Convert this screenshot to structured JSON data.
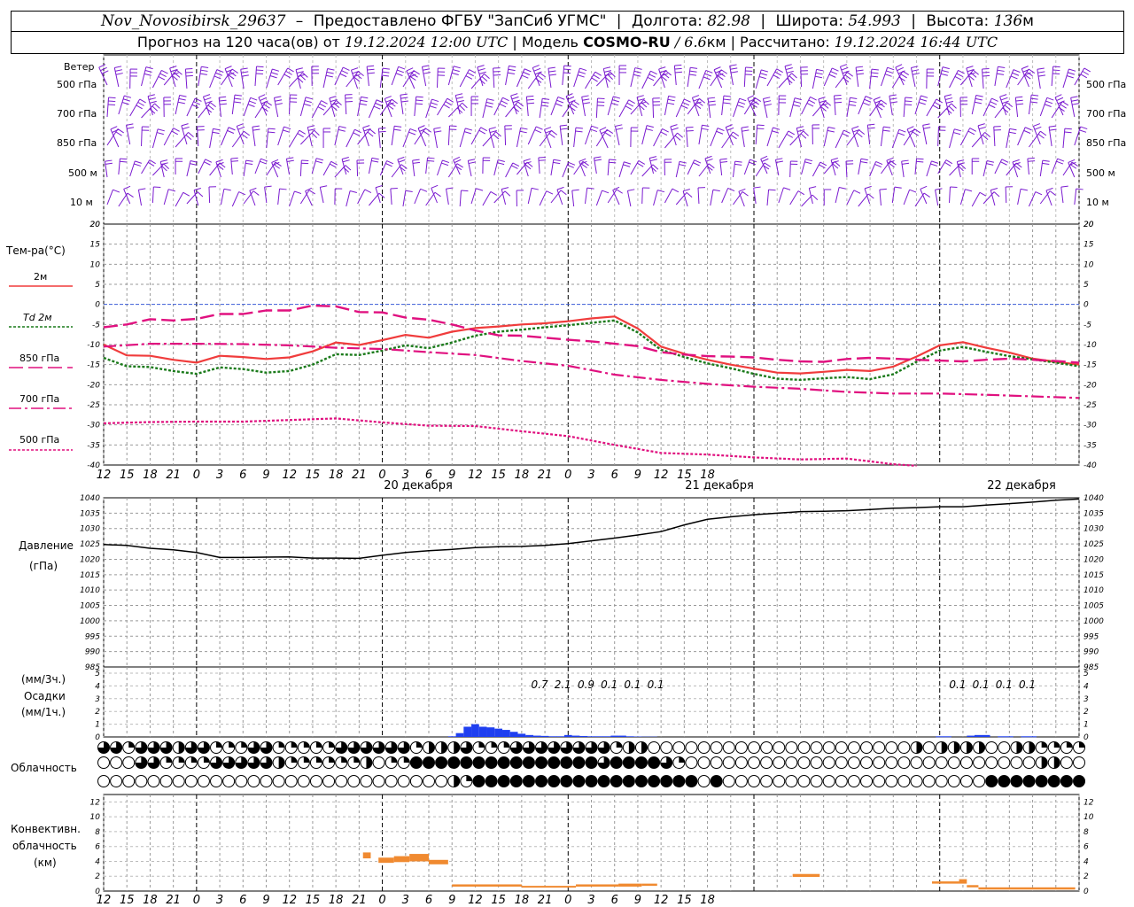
{
  "header": {
    "station": "Nov_Novosibirsk_29637",
    "dash": "–",
    "provider": "Предоставлено ФГБУ \"ЗапСиб УГМС\"",
    "lon_label": "Долгота:",
    "lon_value": "82.98",
    "lat_label": "Широта:",
    "lat_value": "54.993",
    "alt_label": "Высота:",
    "alt_value": "136",
    "alt_unit": "м"
  },
  "subheader": {
    "forecast": "Прогноз на 120 часа(ов) от",
    "init": "19.12.2024 12:00 UTC",
    "model_label": "| Модель",
    "model": "COSMO-RU",
    "resolution": "/ 6.6",
    "res_unit": "км",
    "computed_label": "| Рассчитано:",
    "computed": "19.12.2024 16:44 UTC"
  },
  "labels": {
    "wind": "Ветер",
    "levels": [
      "500 гПа",
      "700 гПа",
      "850 гПа",
      "500 м",
      "10  м"
    ],
    "temp_title": "Тем-ра(°С)",
    "temp_legend": [
      "2м",
      "Td 2м",
      "850 гПа",
      "700 гПа",
      "500 гПа"
    ],
    "pressure_title": "Давление",
    "pressure_unit": "(гПа)",
    "precip_3h": "(мм/3ч.)",
    "precip_title": "Осадки",
    "precip_1h": "(мм/1ч.)",
    "cloud_title": "Облачность",
    "conv_title1": "Конвективн.",
    "conv_title2": "облачность",
    "conv_unit": "(км)"
  },
  "colors": {
    "t2m": "#f03c3c",
    "td2m": "#1a7a1a",
    "t850": "#e0107f",
    "t700": "#e0107f",
    "t500": "#e0107f",
    "wind": "#7a1ad0",
    "precip": "#1f3ff0",
    "conv": "#f08a30",
    "zero_line": "#3b5bd6"
  },
  "chart_data": {
    "x_ticks": [
      "12",
      "15",
      "18",
      "21",
      "0",
      "3",
      "6",
      "9",
      "12",
      "15",
      "18",
      "21",
      "0",
      "3",
      "6",
      "9",
      "12",
      "15",
      "18",
      "21",
      "0",
      "3",
      "6",
      "9",
      "12",
      "15",
      "18"
    ],
    "day_labels": [
      "20 декабря",
      "21 декабря",
      "22 декабря"
    ],
    "temperature": {
      "type": "line",
      "ylim": [
        -40,
        20
      ],
      "yticks": [
        20,
        15,
        10,
        5,
        0,
        -5,
        -10,
        -15,
        -20,
        -25,
        -30,
        -35,
        -40
      ],
      "series": [
        {
          "name": "2м",
          "x": [
            0,
            3,
            6,
            9,
            12,
            15,
            18,
            21,
            24,
            27,
            30,
            33,
            36,
            39,
            42,
            45,
            48,
            51,
            54,
            57,
            60,
            63,
            66,
            69,
            72,
            75,
            78,
            81,
            84,
            87,
            90,
            93,
            96,
            99,
            102,
            105,
            108,
            111,
            114,
            117,
            120,
            123,
            126
          ],
          "values": [
            -10,
            -12.7,
            -12.8,
            -13.8,
            -14.5,
            -12.8,
            -13.1,
            -13.6,
            -13.2,
            -11.7,
            -9.5,
            -10.1,
            -8.9,
            -7.6,
            -8.3,
            -6.8,
            -5.9,
            -5.5,
            -5,
            -4.7,
            -4.2,
            -3.5,
            -3,
            -6,
            -10.5,
            -12.3,
            -13.8,
            -15,
            -16,
            -17,
            -17.2,
            -16.8,
            -16.3,
            -16.6,
            -15.5,
            -13,
            -10.2,
            -9.4,
            -10.8,
            -12,
            -13.5,
            -14.3,
            -15
          ]
        },
        {
          "name": "Td 2м",
          "x": [
            0,
            3,
            6,
            9,
            12,
            15,
            18,
            21,
            24,
            27,
            30,
            33,
            36,
            39,
            42,
            45,
            48,
            51,
            54,
            57,
            60,
            63,
            66,
            69,
            72,
            75,
            78,
            81,
            84,
            87,
            90,
            93,
            96,
            99,
            102,
            105,
            108,
            111,
            114,
            117,
            120,
            123,
            126
          ],
          "values": [
            -13.3,
            -15.4,
            -15.6,
            -16.6,
            -17.3,
            -15.7,
            -16.1,
            -17,
            -16.6,
            -15,
            -12.4,
            -12.6,
            -11.5,
            -10.2,
            -10.9,
            -9.5,
            -7.8,
            -6.8,
            -6.3,
            -5.7,
            -5.2,
            -4.6,
            -4,
            -7,
            -11.3,
            -13.1,
            -14.7,
            -15.9,
            -17.3,
            -18.5,
            -18.8,
            -18.4,
            -18.1,
            -18.6,
            -17.4,
            -14.3,
            -11.5,
            -10.6,
            -11.8,
            -12.9,
            -13.7,
            -14.5,
            -15.4
          ]
        },
        {
          "name": "850 гПа",
          "x": [
            0,
            3,
            6,
            9,
            12,
            15,
            18,
            21,
            24,
            27,
            30,
            33,
            36,
            39,
            42,
            45,
            48,
            51,
            54,
            57,
            60,
            63,
            66,
            69,
            72,
            75,
            78,
            81,
            84,
            87,
            90,
            93,
            96,
            99,
            102,
            105,
            108,
            111,
            114,
            117,
            120,
            123,
            126
          ],
          "values": [
            -5.7,
            -5,
            -3.7,
            -4,
            -3.6,
            -2.4,
            -2.4,
            -1.5,
            -1.5,
            -0.3,
            -0.5,
            -1.9,
            -2,
            -3.3,
            -3.8,
            -5,
            -6.5,
            -7.7,
            -7.8,
            -8.3,
            -8.8,
            -9.2,
            -9.8,
            -10.4,
            -11.9,
            -12.5,
            -12.9,
            -13,
            -13.2,
            -13.8,
            -14.2,
            -14.3,
            -13.6,
            -13.3,
            -13.5,
            -13.8,
            -14,
            -14.2,
            -13.8,
            -13.5,
            -13.8,
            -14.1,
            -14.5
          ]
        },
        {
          "name": "700 гПа",
          "x": [
            0,
            6,
            12,
            18,
            24,
            30,
            36,
            42,
            48,
            54,
            60,
            66,
            72,
            78,
            84,
            90,
            96,
            102,
            108,
            114,
            120,
            126
          ],
          "values": [
            -10.5,
            -9.8,
            -9.8,
            -9.9,
            -10.2,
            -10.8,
            -11.1,
            -11.9,
            -12.6,
            -14.1,
            -15.3,
            -17.5,
            -18.8,
            -19.8,
            -20.5,
            -21,
            -21.8,
            -22.2,
            -22.2,
            -22.5,
            -22.9,
            -23.3
          ]
        },
        {
          "name": "500 гПа",
          "x": [
            0,
            6,
            12,
            18,
            24,
            30,
            36,
            42,
            48,
            54,
            60,
            66,
            72,
            78,
            84,
            90,
            96,
            102,
            105
          ],
          "values": [
            -29.6,
            -29.3,
            -29.2,
            -29.2,
            -28.8,
            -28.4,
            -29.4,
            -30.2,
            -30.3,
            -31.6,
            -32.8,
            -35,
            -37,
            -37.4,
            -38.1,
            -38.6,
            -38.4,
            -39.8,
            -40.2
          ]
        }
      ]
    },
    "pressure": {
      "type": "line",
      "ylim": [
        985,
        1040
      ],
      "yticks": [
        1040,
        1035,
        1030,
        1025,
        1020,
        1015,
        1010,
        1005,
        1000,
        995,
        990,
        985
      ],
      "x": [
        0,
        3,
        6,
        9,
        12,
        15,
        18,
        21,
        24,
        27,
        30,
        33,
        36,
        39,
        42,
        45,
        48,
        51,
        54,
        57,
        60,
        63,
        66,
        69,
        72,
        75,
        78,
        81,
        84,
        87,
        90,
        93,
        96,
        99,
        102,
        105,
        108,
        111,
        114,
        117,
        120,
        123,
        126
      ],
      "values": [
        1024.8,
        1024.5,
        1023.6,
        1023.1,
        1022.2,
        1020.6,
        1020.6,
        1020.7,
        1020.8,
        1020.4,
        1020.4,
        1020.3,
        1021.3,
        1022.2,
        1022.8,
        1023.2,
        1023.8,
        1024.1,
        1024.2,
        1024.5,
        1025.1,
        1026,
        1026.9,
        1027.9,
        1029,
        1031.2,
        1033,
        1033.8,
        1034.5,
        1035,
        1035.5,
        1035.6,
        1035.8,
        1036.2,
        1036.6,
        1036.8,
        1037.1,
        1037.1,
        1037.6,
        1038.1,
        1038.6,
        1039.2,
        1039.6
      ]
    },
    "precipitation": {
      "type": "bar",
      "ylim": [
        0,
        5
      ],
      "yticks": [
        5,
        4,
        3,
        2,
        1,
        0
      ],
      "x": [
        45,
        46,
        47,
        48,
        49,
        50,
        51,
        52,
        53,
        54,
        55,
        56,
        57,
        58,
        59,
        60,
        61,
        62,
        63,
        64,
        65,
        66,
        67,
        68,
        69,
        70,
        71,
        72,
        73,
        74,
        75,
        76,
        77,
        78,
        79,
        80,
        81,
        82,
        83,
        84,
        85,
        86,
        87,
        88,
        89,
        90,
        91,
        92,
        93,
        94,
        95,
        96,
        97,
        98,
        99,
        100,
        101,
        102,
        103,
        104,
        105,
        106,
        107,
        108,
        109,
        110,
        111,
        112,
        113,
        114,
        115,
        116,
        117,
        118,
        119,
        120,
        121,
        122,
        123,
        124,
        125,
        126
      ],
      "values": [
        0.05,
        0.3,
        0.8,
        1.0,
        0.8,
        0.75,
        0.65,
        0.55,
        0.4,
        0.25,
        0.15,
        0.1,
        0.08,
        0.05,
        0.05,
        0.15,
        0.1,
        0.07,
        0.05,
        0.05,
        0.05,
        0.1,
        0.1,
        0.05,
        0.03,
        0.02,
        0.02,
        0,
        0,
        0,
        0,
        0,
        0,
        0,
        0,
        0,
        0,
        0,
        0,
        0,
        0,
        0,
        0,
        0,
        0,
        0,
        0,
        0,
        0,
        0,
        0,
        0,
        0,
        0,
        0,
        0,
        0,
        0,
        0,
        0,
        0,
        0,
        0,
        0,
        0,
        0,
        0,
        0,
        0,
        0,
        0,
        0,
        0,
        0,
        0,
        0,
        0,
        0,
        0,
        0,
        0,
        0
      ],
      "totals_3h": [
        {
          "x": 57,
          "value": "0.7"
        },
        {
          "x": 60,
          "value": "2.1"
        },
        {
          "x": 63,
          "value": "0.9"
        },
        {
          "x": 66,
          "value": "0.1"
        },
        {
          "x": 69,
          "value": "0.1"
        },
        {
          "x": 72,
          "value": "0.1"
        },
        {
          "x": 111,
          "value": "0.1"
        },
        {
          "x": 114,
          "value": "0.1"
        },
        {
          "x": 117,
          "value": "0.1"
        },
        {
          "x": 120,
          "value": "0.1"
        }
      ],
      "late_bars": [
        {
          "x": 108,
          "v": 0.05
        },
        {
          "x": 112,
          "v": 0.1
        },
        {
          "x": 113,
          "v": 0.15
        },
        {
          "x": 116,
          "v": 0.05
        },
        {
          "x": 119,
          "v": 0.05
        }
      ]
    },
    "cloud_cover_rows": {
      "count": 79,
      "high": "3313332331113311111333333122231113333333312200000000000000000000020222200221111",
      "mid": "0003311113333321111112011444444444444444344443100000000000000000000000000002200",
      "low": "0000000000000000000000000000214444444444444444440400000000000000000000044444444"
    },
    "convective_cloud": {
      "type": "bar",
      "ylim": [
        0,
        13
      ],
      "yticks": [
        12,
        10,
        8,
        6,
        4,
        2,
        0
      ],
      "segments": [
        {
          "x0": 33.5,
          "x1": 34.5,
          "bottom": 4.4,
          "top": 5.2
        },
        {
          "x0": 35.5,
          "x1": 37.5,
          "bottom": 3.8,
          "top": 4.5
        },
        {
          "x0": 37.5,
          "x1": 39.5,
          "bottom": 3.9,
          "top": 4.7
        },
        {
          "x0": 39.5,
          "x1": 42.0,
          "bottom": 4.0,
          "top": 5.0
        },
        {
          "x0": 42.0,
          "x1": 44.5,
          "bottom": 3.6,
          "top": 4.2
        },
        {
          "x0": 45.0,
          "x1": 54.0,
          "bottom": 0.6,
          "top": 0.9
        },
        {
          "x0": 54.0,
          "x1": 61.0,
          "bottom": 0.5,
          "top": 0.7
        },
        {
          "x0": 61.0,
          "x1": 66.5,
          "bottom": 0.6,
          "top": 0.9
        },
        {
          "x0": 66.5,
          "x1": 69.5,
          "bottom": 0.6,
          "top": 1.0
        },
        {
          "x0": 69.5,
          "x1": 71.5,
          "bottom": 0.7,
          "top": 1.0
        },
        {
          "x0": 89.0,
          "x1": 92.5,
          "bottom": 1.9,
          "top": 2.3
        },
        {
          "x0": 107.0,
          "x1": 110.5,
          "bottom": 1.0,
          "top": 1.3
        },
        {
          "x0": 110.5,
          "x1": 111.5,
          "bottom": 1.0,
          "top": 1.6
        },
        {
          "x0": 111.5,
          "x1": 113.0,
          "bottom": 0.5,
          "top": 0.8
        },
        {
          "x0": 113.0,
          "x1": 125.5,
          "bottom": 0.2,
          "top": 0.5
        }
      ]
    }
  }
}
